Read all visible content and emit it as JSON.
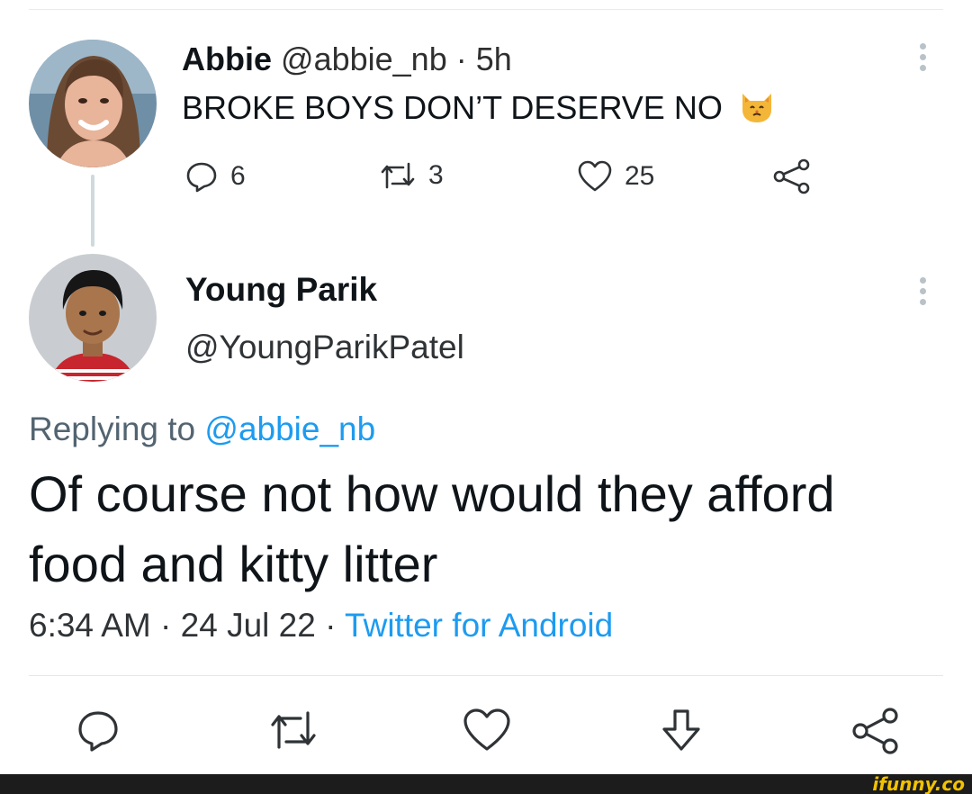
{
  "tweet1": {
    "name": "Abbie",
    "handle": "@abbie_nb",
    "separator": " · ",
    "time": "5h",
    "text": "BROKE BOYS DON’T DESERVE NO",
    "emoji_icon": "cat-face-icon",
    "replies": "6",
    "retweets": "3",
    "likes": "25"
  },
  "tweet2": {
    "name": "Young Parik",
    "handle": "@YoungParikPatel",
    "replying_prefix": "Replying to ",
    "replying_to": "@abbie_nb",
    "text": "Of course not how would they afford food and kitty litter",
    "time": "6:34 AM",
    "sep1": " · ",
    "date": "24 Jul 22",
    "sep2": " · ",
    "source": "Twitter for Android"
  },
  "watermark": {
    "text": "ifunny.co"
  },
  "colors": {
    "link": "#1d9bf0",
    "text": "#0f1419",
    "secondary": "#536471",
    "watermark": "#f2c200"
  }
}
